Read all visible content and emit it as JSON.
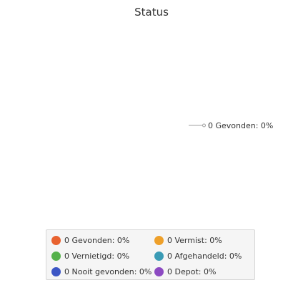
{
  "chart_data": {
    "type": "pie",
    "title": "Status",
    "slices": [
      {
        "label": "Gevonden",
        "value": 0,
        "percent": 0,
        "display": "0 Gevonden: 0%",
        "color": "#e8622f"
      },
      {
        "label": "Vermist",
        "value": 0,
        "percent": 0,
        "display": "0 Vermist: 0%",
        "color": "#eea02a"
      },
      {
        "label": "Vernietigd",
        "value": 0,
        "percent": 0,
        "display": "0 Vernietigd: 0%",
        "color": "#55b14b"
      },
      {
        "label": "Afgehandeld",
        "value": 0,
        "percent": 0,
        "display": "0 Afgehandeld: 0%",
        "color": "#3a9bb5"
      },
      {
        "label": "Nooit gevonden",
        "value": 0,
        "percent": 0,
        "display": "0 Nooit gevonden: 0%",
        "color": "#3b55c4"
      },
      {
        "label": "Depot",
        "value": 0,
        "percent": 0,
        "display": "0 Depot: 0%",
        "color": "#8c4ac2"
      }
    ],
    "data_labels": [
      "0 Gevonden: 0%"
    ],
    "legend_position": "bottom"
  }
}
